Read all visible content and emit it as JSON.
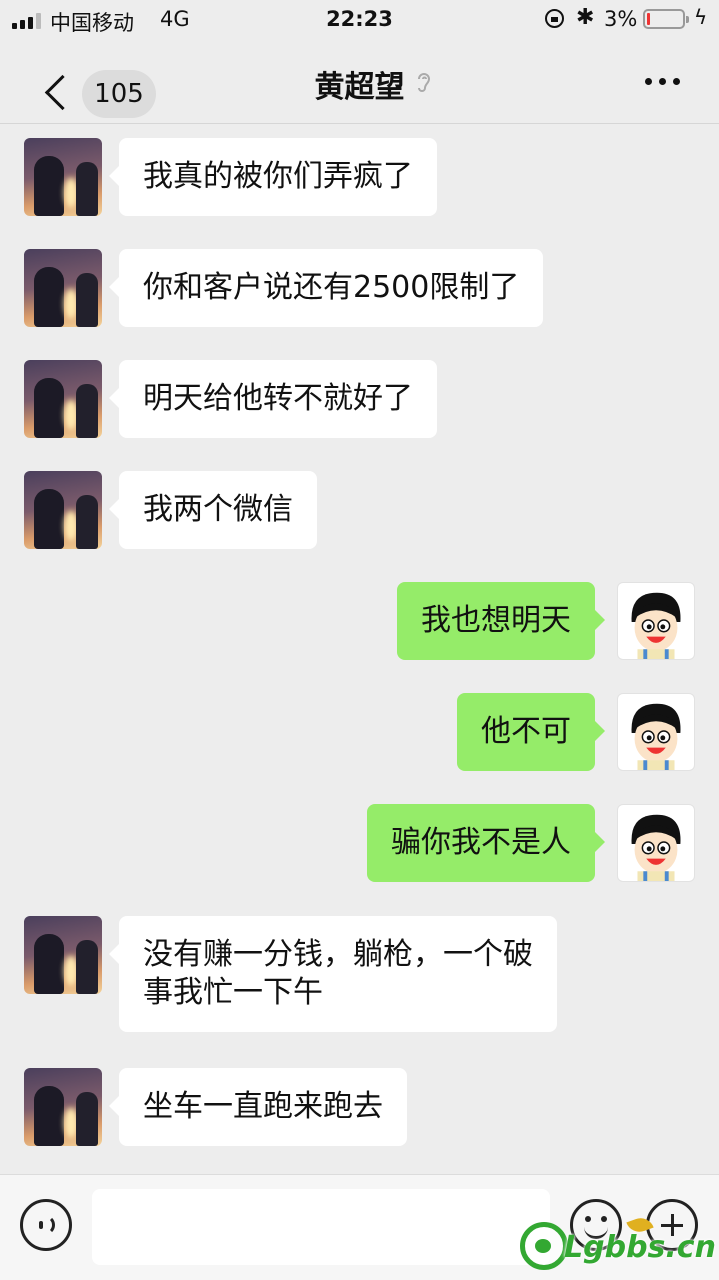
{
  "status_bar": {
    "carrier": "中国移动",
    "network": "4G",
    "time": "22:23",
    "battery_percent": "3%",
    "battery_level": 0.03
  },
  "nav": {
    "unread_count": "105",
    "title": "黄超望"
  },
  "messages": [
    {
      "side": "in",
      "avatar": "anime-couple-avatar",
      "text": "我真的被你们弄疯了"
    },
    {
      "side": "in",
      "avatar": "anime-couple-avatar",
      "text": "你和客户说还有2500限制了"
    },
    {
      "side": "in",
      "avatar": "anime-couple-avatar",
      "text": "明天给他转不就好了"
    },
    {
      "side": "in",
      "avatar": "anime-couple-avatar",
      "text": "我两个微信"
    },
    {
      "side": "out",
      "avatar": "cartoon-boy-avatar",
      "text": "我也想明天"
    },
    {
      "side": "out",
      "avatar": "cartoon-boy-avatar",
      "text": "他不可"
    },
    {
      "side": "out",
      "avatar": "cartoon-boy-avatar",
      "text": "骗你我不是人"
    },
    {
      "side": "in",
      "avatar": "anime-couple-avatar",
      "text": "没有赚一分钱，躺枪，一个破\n事我忙一下午"
    },
    {
      "side": "in",
      "avatar": "anime-couple-avatar",
      "text": "坐车一直跑来跑去"
    }
  ],
  "input": {
    "value": ""
  },
  "watermark": {
    "text": "Lgbbs.cn"
  },
  "colors": {
    "background": "#ededed",
    "incoming_bubble": "#ffffff",
    "outgoing_bubble": "#95ec69",
    "watermark": "#33a832"
  }
}
